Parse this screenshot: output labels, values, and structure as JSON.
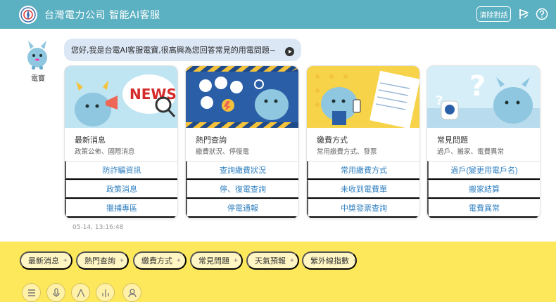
{
  "header": {
    "title": "台灣電力公司 智能AI客服",
    "clear_label": "清除對話",
    "logo_icon": "taipower-logo",
    "feedback_icon": "feedback-flag-icon",
    "help_icon": "help-icon"
  },
  "bot": {
    "name": "電寶",
    "greeting": "您好,我是台電AI客服電寶,很高興為您回答常見的用電問題~"
  },
  "cards": [
    {
      "title": "最新消息",
      "subtitle": "政策公佈、國際消息",
      "links": [
        "防詐騙資訊",
        "政策消息",
        "獵捕專區"
      ]
    },
    {
      "title": "熱門查詢",
      "subtitle": "繳費狀況、停復電",
      "links": [
        "查詢繳費狀況",
        "停、復電查詢",
        "停電通報"
      ]
    },
    {
      "title": "繳費方式",
      "subtitle": "常用繳費方式、發票",
      "links": [
        "常用繳費方式",
        "未收到電費單",
        "中獎發票查詢"
      ]
    },
    {
      "title": "常見問題",
      "subtitle": "過戶、搬家、電費異常",
      "links": [
        "過戶(變更用電戶名)",
        "搬家結算",
        "電費異常"
      ]
    }
  ],
  "timestamp": "05-14, 13:16:48",
  "quick_chips": [
    {
      "label": "最新消息",
      "plus": "+"
    },
    {
      "label": "熱門查詢",
      "plus": "+"
    },
    {
      "label": "繳費方式",
      "plus": "+"
    },
    {
      "label": "常見問題",
      "plus": "+"
    },
    {
      "label": "天氣預報",
      "plus": "+"
    },
    {
      "label": "紫外線指數",
      "plus": "+"
    }
  ],
  "toolbar_icons": [
    "menu-icon",
    "microphone-icon",
    "text-size-large-icon",
    "text-size-small-icon",
    "user-icon"
  ],
  "colors": {
    "header": "#5bb0c1",
    "bottom_panel": "#fde75a",
    "chip": "#fff6c4",
    "link": "#2f7fc0",
    "bubble": "#dbe7f5"
  }
}
